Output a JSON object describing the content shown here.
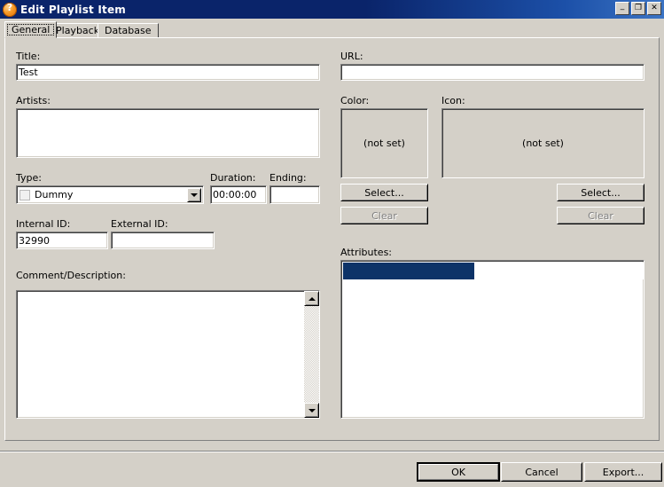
{
  "window": {
    "title": "Edit Playlist Item",
    "icon": "app-orb-icon",
    "buttons": {
      "minimize": "_",
      "maximize": "❐",
      "close": "✕"
    },
    "titlebar_color": "#0a246a"
  },
  "tabs": [
    {
      "label": "General",
      "active": true
    },
    {
      "label": "Playback",
      "active": false
    },
    {
      "label": "Database",
      "active": false
    }
  ],
  "general": {
    "title": {
      "label": "Title:",
      "value": "Test"
    },
    "artists": {
      "label": "Artists:",
      "value": ""
    },
    "type": {
      "label": "Type:",
      "value": "Dummy",
      "swatch_color": "#f0f0f0"
    },
    "duration": {
      "label": "Duration:",
      "value": "00:00:00"
    },
    "ending": {
      "label": "Ending:",
      "value": ""
    },
    "internal_id": {
      "label": "Internal ID:",
      "value": "32990"
    },
    "external_id": {
      "label": "External ID:",
      "value": ""
    },
    "comment": {
      "label": "Comment/Description:",
      "value": ""
    },
    "url": {
      "label": "URL:",
      "value": ""
    },
    "color": {
      "label": "Color:",
      "preview": "(not set)",
      "select_label": "Select...",
      "clear_label": "Clear",
      "clear_enabled": false
    },
    "icon": {
      "label": "Icon:",
      "preview": "(not set)",
      "select_label": "Select...",
      "clear_label": "Clear",
      "clear_enabled": false
    },
    "attributes": {
      "label": "Attributes:",
      "selection_color": "#0d3368",
      "rows": [
        {
          "name": "",
          "value": "",
          "selected": true
        }
      ]
    }
  },
  "footer": {
    "ok_label": "OK",
    "cancel_label": "Cancel",
    "export_label": "Export..."
  }
}
